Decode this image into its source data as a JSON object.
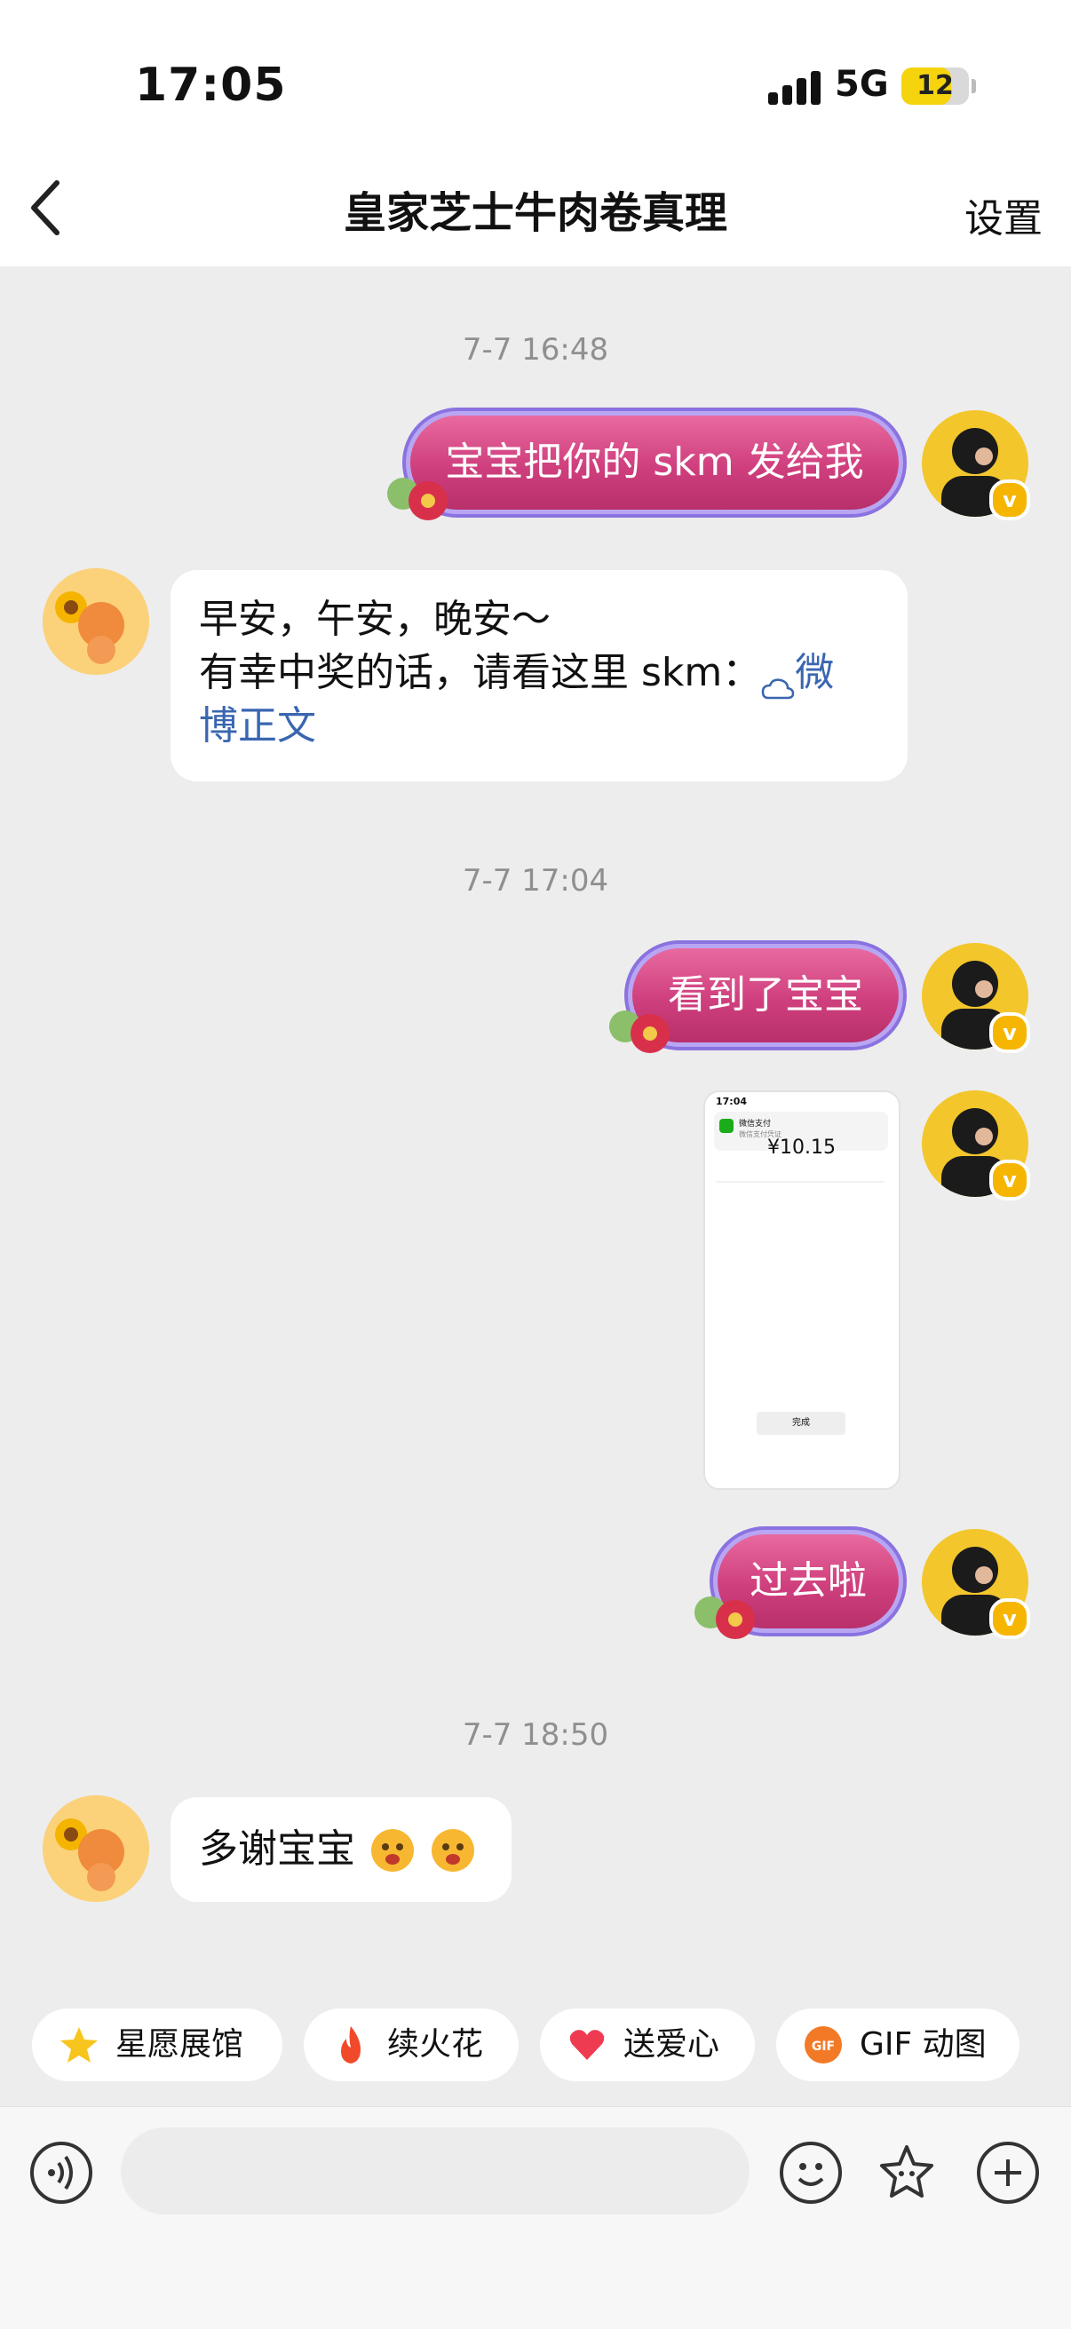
{
  "status_bar": {
    "time": "17:05",
    "network": "5G",
    "battery": "12"
  },
  "nav": {
    "title": "皇家芝士牛肉卷真理",
    "settings_label": "设置"
  },
  "messages": {
    "ts1": "7-7 16:48",
    "m1": "宝宝把你的 skm 发给我",
    "m2_line1": "早安，午安，晚安～",
    "m2_line2_text": "有幸中奖的话，请看这里 skm：",
    "m2_link_a": "微",
    "m2_link_b": "博正文",
    "ts2": "7-7 17:04",
    "m3": "看到了宝宝",
    "shot_time": "17:04",
    "shot_app": "微信支付",
    "shot_sub": "微信支付凭证",
    "shot_amount": "¥10.15",
    "shot_done": "完成",
    "m4": "过去啦",
    "ts3": "7-7 18:50",
    "m5": "多谢宝宝"
  },
  "quick_actions": [
    {
      "label": "星愿展馆",
      "icon": "star-icon"
    },
    {
      "label": "续火花",
      "icon": "fire-icon"
    },
    {
      "label": "送爱心",
      "icon": "heart-icon"
    },
    {
      "label": "GIF 动图",
      "icon": "gif-icon"
    }
  ],
  "colors": {
    "bubble_pink": "#cf3f7d",
    "link": "#3a66b0",
    "accent_yellow": "#f5d40d"
  }
}
